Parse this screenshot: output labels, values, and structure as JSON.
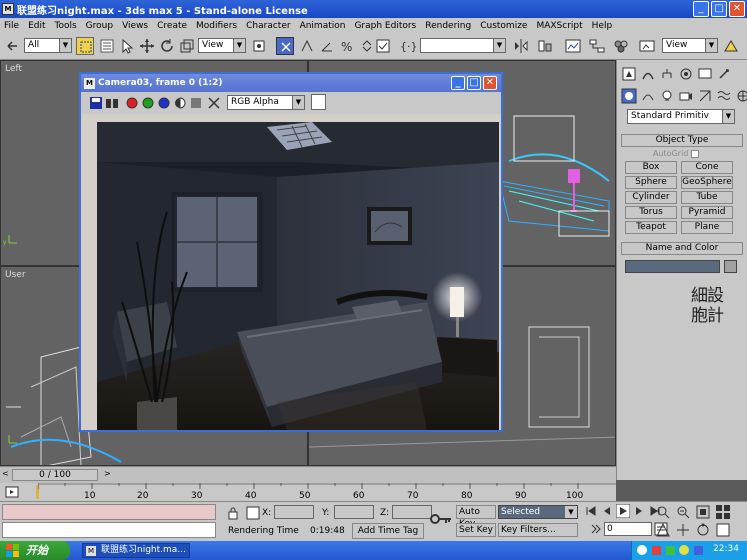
{
  "window": {
    "title": "联盟练习night.max - 3ds max 5 - Stand-alone License",
    "app_icon": "3ds-max-icon",
    "buttons": [
      "minimize",
      "maximize",
      "close"
    ]
  },
  "menu": {
    "items": [
      "File",
      "Edit",
      "Tools",
      "Group",
      "Views",
      "Create",
      "Modifiers",
      "Character",
      "Animation",
      "Graph Editors",
      "Rendering",
      "Customize",
      "MAXScript",
      "Help"
    ]
  },
  "toolbar": {
    "selection_filter": "All",
    "reference_coord": "View",
    "named_sets": "",
    "view_right": "View"
  },
  "viewports": {
    "top_left_label": "Left",
    "bottom_left_label": "User"
  },
  "render_window": {
    "title": "Camera03, frame 0 (1:2)",
    "channel": "RGB Alpha",
    "colors": {
      "red": "#e02020",
      "green": "#20a020",
      "blue": "#2030d0"
    }
  },
  "command_panel": {
    "dropdown": "Standard Primitiv",
    "object_type_title": "Object Type",
    "autogrid": "AutoGrid",
    "buttons": [
      "Box",
      "Cone",
      "Sphere",
      "GeoSphere",
      "Cylinder",
      "Tube",
      "Torus",
      "Pyramid",
      "Teapot",
      "Plane"
    ],
    "name_color_title": "Name and Color",
    "watermark": "細設胞計"
  },
  "timeline": {
    "frame_display": "0 / 100",
    "ticks": [
      "10",
      "20",
      "30",
      "40",
      "50",
      "60",
      "70",
      "80",
      "90",
      "100"
    ]
  },
  "status": {
    "x_label": "X:",
    "y_label": "Y:",
    "z_label": "Z:",
    "rendering_time_label": "Rendering Time",
    "rendering_time": "0:19:48",
    "add_time_tag": "Add Time Tag",
    "auto_key": "Auto Key",
    "set_key": "Set Key",
    "selected": "Selected",
    "key_filters": "Key Filters...",
    "frame_value": "0"
  },
  "taskbar": {
    "start": "开始",
    "item": "联盟练习night.ma...",
    "clock": "22:34"
  }
}
